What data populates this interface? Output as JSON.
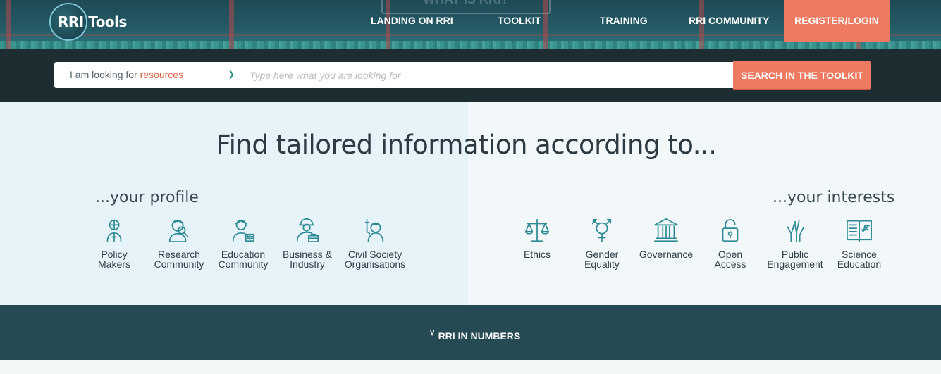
{
  "header": {
    "logo_text": "RRI Tools",
    "ghost_button_label": "WHAT IS RRI?",
    "nav": [
      {
        "label": "LANDING ON RRI"
      },
      {
        "label": "TOOLKIT"
      },
      {
        "label": "TRAINING"
      },
      {
        "label": "RRI COMMUNITY"
      },
      {
        "label": "REGISTER/LOGIN"
      }
    ]
  },
  "search": {
    "select_prefix": "I am looking for",
    "select_value": "resources",
    "placeholder": "Type here what you are looking for",
    "button_label": "SEARCH IN THE TOOLKIT"
  },
  "main": {
    "title": "Find tailored information according to...",
    "profile": {
      "heading": "...your profile",
      "items": [
        {
          "label": "Policy\nMakers",
          "icon": "policy-makers-icon"
        },
        {
          "label": "Research\nCommunity",
          "icon": "research-community-icon"
        },
        {
          "label": "Education\nCommunity",
          "icon": "education-community-icon"
        },
        {
          "label": "Business &\nIndustry",
          "icon": "business-industry-icon"
        },
        {
          "label": "Civil Society\nOrganisations",
          "icon": "civil-society-icon"
        }
      ]
    },
    "interests": {
      "heading": "...your interests",
      "items": [
        {
          "label": "Ethics",
          "icon": "scales-icon"
        },
        {
          "label": "Gender\nEquality",
          "icon": "gender-icon"
        },
        {
          "label": "Governance",
          "icon": "building-icon"
        },
        {
          "label": "Open\nAccess",
          "icon": "open-lock-icon"
        },
        {
          "label": "Public\nEngagement",
          "icon": "raised-hands-icon"
        },
        {
          "label": "Science\nEducation",
          "icon": "book-icon"
        }
      ]
    }
  },
  "numbers": {
    "label": "RRI IN NUMBERS"
  },
  "colors": {
    "accent": "#ee7a62",
    "teal": "#2e8a94",
    "dark_band": "#1d2d32",
    "numbers_band": "#264a54"
  }
}
